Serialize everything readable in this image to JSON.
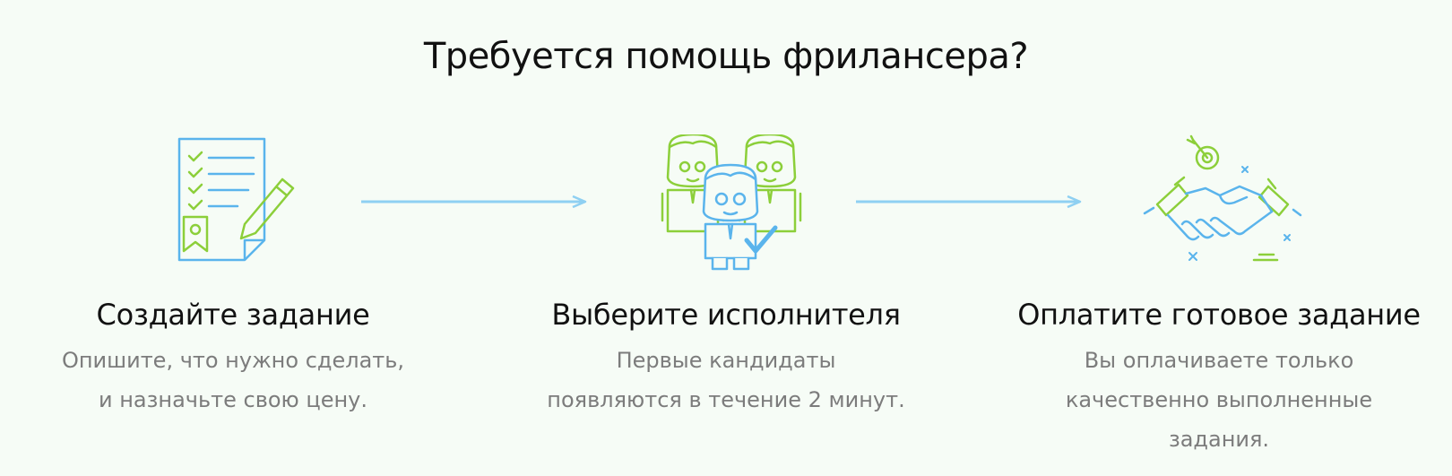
{
  "page": {
    "title": "Требуется помощь фрилансера?"
  },
  "colors": {
    "background": "#f6fcf6",
    "accent_green": "#8ccf3a",
    "accent_blue": "#5ab4ec",
    "arrow": "#8fd0f2",
    "heading": "#111111",
    "description": "#7c7c7c"
  },
  "steps": [
    {
      "icon": "document-pencil-icon",
      "heading": "Создайте задание",
      "description": "Опишите, что нужно сделать, и назначьте свою цену."
    },
    {
      "icon": "choose-freelancer-icon",
      "heading": "Выберите исполнителя",
      "description": "Первые кандидаты появляются в течение 2 минут."
    },
    {
      "icon": "handshake-icon",
      "heading": "Оплатите готовое задание",
      "description": "Вы оплачиваете только качественно выполненные задания."
    }
  ]
}
